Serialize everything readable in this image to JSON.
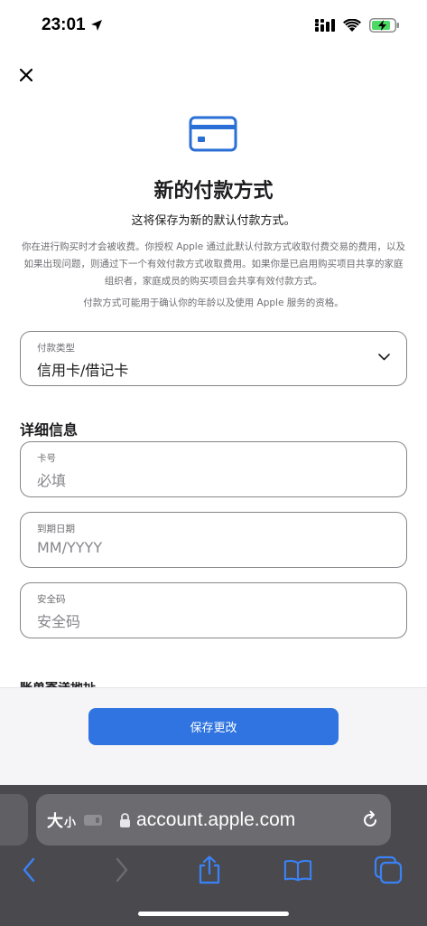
{
  "status_bar": {
    "time": "23:01",
    "icons": [
      "location-arrow-icon",
      "cellular-signal-icon",
      "wifi-icon",
      "battery-charging-icon"
    ]
  },
  "header": {
    "close_icon": "close-icon",
    "hero_icon": "credit-card-icon",
    "title": "新的付款方式",
    "subtitle": "这将保存为新的默认付款方式。",
    "disclaimer": "你在进行购买时才会被收费。你授权 Apple 通过此默认付款方式收取付费交易的费用，以及如果出现问题，则通过下一个有效付款方式收取费用。如果你是已启用购买项目共享的家庭组织者，家庭成员的购买项目会共享有效付款方式。",
    "age_notice": "付款方式可能用于确认你的年龄以及使用 Apple 服务的资格。"
  },
  "payment_type": {
    "label": "付款类型",
    "value": "信用卡/借记卡"
  },
  "details": {
    "heading": "详细信息",
    "card_number": {
      "label": "卡号",
      "placeholder": "必填"
    },
    "expiry": {
      "label": "到期日期",
      "placeholder": "MM/YYYY"
    },
    "security_code": {
      "label": "安全码",
      "placeholder": "安全码"
    },
    "next_section_partial": "账单寄送地址"
  },
  "actions": {
    "save_label": "保存更改"
  },
  "browser": {
    "text_size_label_big": "大",
    "text_size_label_small": "小",
    "url": "account.apple.com"
  },
  "colors": {
    "accent": "#2f74e0",
    "hero_icon": "#2a6fd6",
    "toolbar_icon": "#3a82f7"
  }
}
